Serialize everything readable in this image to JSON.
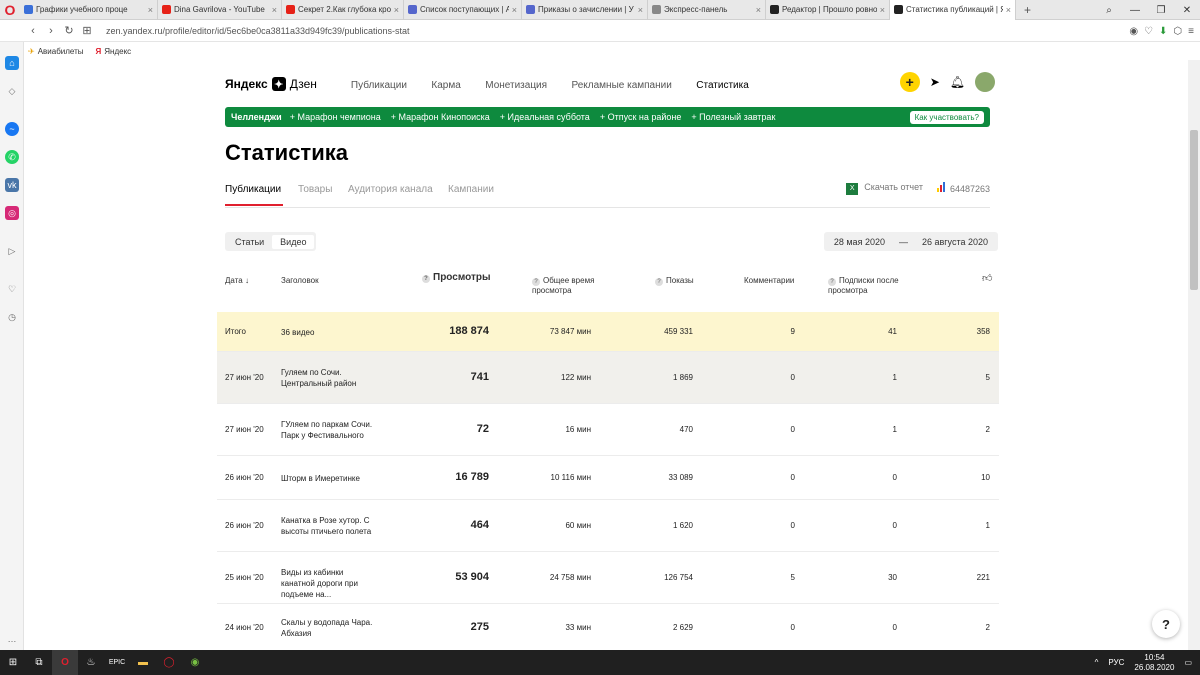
{
  "browser": {
    "tabs": [
      {
        "title": "Графики учебного проце",
        "fav": "#3a6fd8",
        "icon": "doc-icon"
      },
      {
        "title": "Dina Gavrilova - YouTube",
        "fav": "#e62117",
        "icon": "youtube-icon"
      },
      {
        "title": "Секрет 2.Как глубока кро",
        "fav": "#e62117",
        "icon": "youtube-icon"
      },
      {
        "title": "Список поступающих | Аб",
        "fav": "#5566cc",
        "icon": "university-icon"
      },
      {
        "title": "Приказы о зачислении | У",
        "fav": "#5566cc",
        "icon": "university-icon"
      },
      {
        "title": "Экспресс-панель",
        "fav": "#888888",
        "icon": "grid-icon"
      },
      {
        "title": "Редактор | Прошло ровно",
        "fav": "#222222",
        "icon": "zen-icon"
      },
      {
        "title": "Статистика публикаций | Я",
        "fav": "#222222",
        "icon": "zen-icon"
      }
    ],
    "url": "zen.yandex.ru/profile/editor/id/5ec6be0ca3811a33d949fc39/publications-stat",
    "bookmarks": [
      {
        "label": "Авиабилеты",
        "icon": "plane-icon"
      },
      {
        "label": "Яндекс",
        "icon": "yandex-icon"
      }
    ]
  },
  "header": {
    "logo_text": "Яндекс",
    "logo_text2": "Дзен",
    "menu": [
      "Публикации",
      "Карма",
      "Монетизация",
      "Рекламные кампании",
      "Статистика"
    ]
  },
  "challenge": {
    "title": "Челленджи",
    "items": [
      "+ Марафон чемпиона",
      "+ Марафон Кинопоиска",
      "+ Идеальная суббота",
      "+ Отпуск на районе",
      "+ Полезный завтрак"
    ],
    "button": "Как участвовать?"
  },
  "page_title": "Статистика",
  "stat_tabs": [
    "Публикации",
    "Товары",
    "Аудитория канала",
    "Кампании"
  ],
  "download_report": "Скачать отчет",
  "counter_id": "64487263",
  "segment": [
    "Статьи",
    "Видео"
  ],
  "date_from": "28 мая 2020",
  "date_sep": "—",
  "date_to": "26 августа 2020",
  "columns": {
    "date": "Дата",
    "title": "Заголовок",
    "views": "Просмотры",
    "time": "Общее время просмотра",
    "shows": "Показы",
    "comments": "Комментарии",
    "subs": "Подписки после просмотра"
  },
  "total": {
    "date": "Итого",
    "title": "36 видео",
    "views": "188 874",
    "time": "73 847 мин",
    "shows": "459 331",
    "comments": "9",
    "subs": "41",
    "likes": "358"
  },
  "rows": [
    {
      "date": "27 июн '20",
      "title": "Гуляем по Сочи. Центральный район",
      "views": "741",
      "time": "122 мин",
      "shows": "1 869",
      "comments": "0",
      "subs": "1",
      "likes": "5"
    },
    {
      "date": "27 июн '20",
      "title": "ГУляем по паркам Сочи. Парк у Фестивального",
      "views": "72",
      "time": "16 мин",
      "shows": "470",
      "comments": "0",
      "subs": "1",
      "likes": "2"
    },
    {
      "date": "26 июн '20",
      "title": "Шторм в Имеретинке",
      "views": "16 789",
      "time": "10 116 мин",
      "shows": "33 089",
      "comments": "0",
      "subs": "0",
      "likes": "10"
    },
    {
      "date": "26 июн '20",
      "title": "Канатка в Розе хутор. С высоты птичьего полета",
      "views": "464",
      "time": "60 мин",
      "shows": "1 620",
      "comments": "0",
      "subs": "0",
      "likes": "1"
    },
    {
      "date": "25 июн '20",
      "title": "Виды из кабинки канатной дороги при подъеме на...",
      "views": "53 904",
      "time": "24 758 мин",
      "shows": "126 754",
      "comments": "5",
      "subs": "30",
      "likes": "221"
    },
    {
      "date": "24 июн '20",
      "title": "Скалы у водопада Чара. Абхазия",
      "views": "275",
      "time": "33 мин",
      "shows": "2 629",
      "comments": "0",
      "subs": "0",
      "likes": "2"
    }
  ],
  "help": "?",
  "taskbar": {
    "lang": "РУС",
    "time": "10:54",
    "date": "26.08.2020"
  },
  "colors": {
    "accent_green": "#0e8a3e",
    "accent_red": "#e0202e",
    "total_row": "#fdf6cf",
    "hover_row": "#f1f0ec"
  }
}
